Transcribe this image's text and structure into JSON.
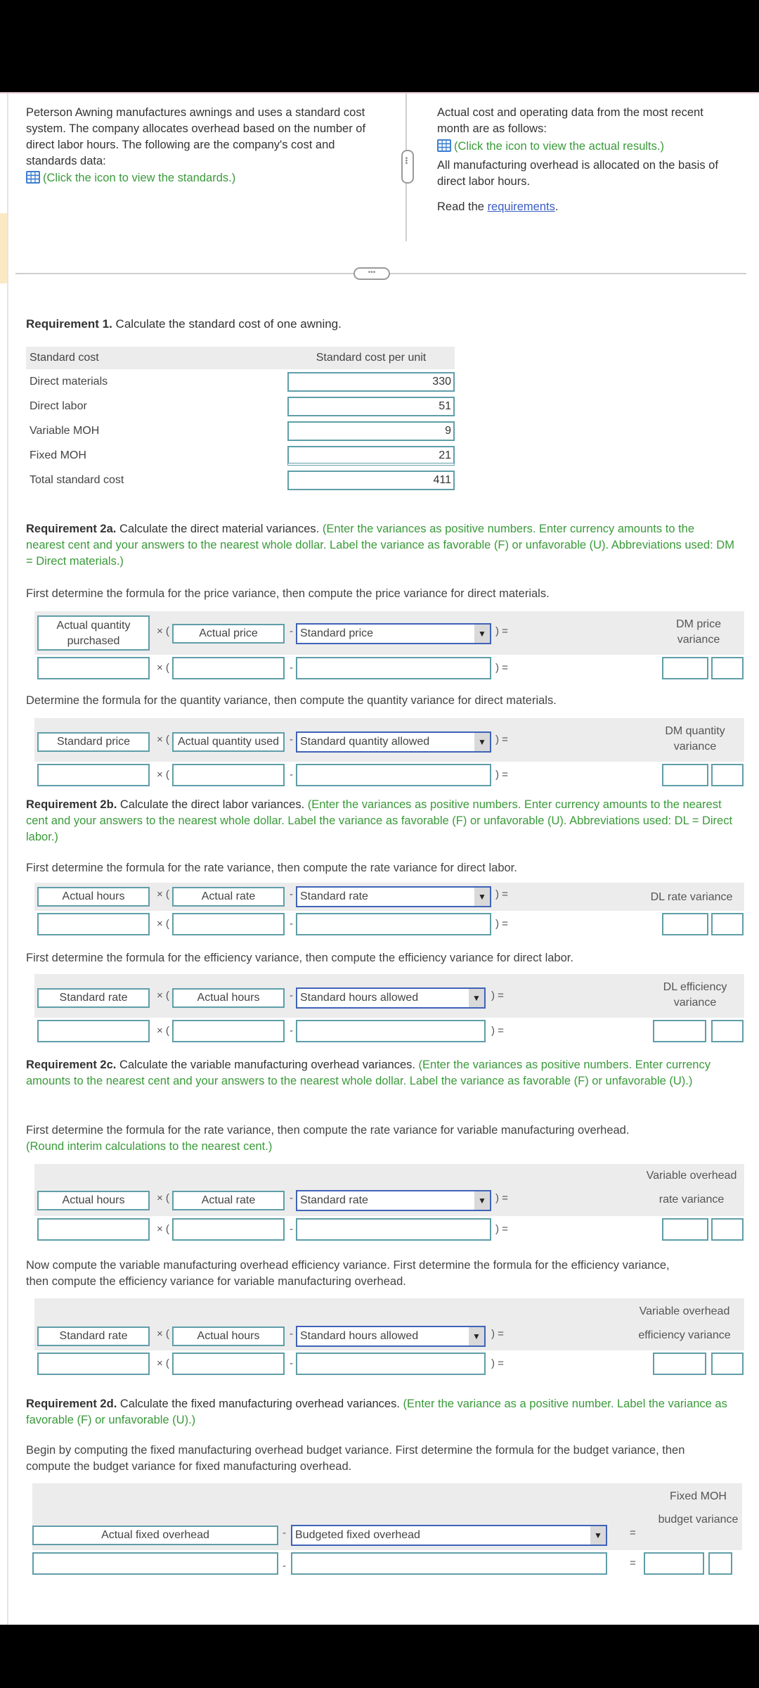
{
  "intro": {
    "left_text": "Peterson Awning manufactures awnings and uses a standard cost system. The company allocates overhead based on the number of direct labor hours. The following are the company's cost and standards data:",
    "left_link": "(Click the icon to view the standards.)",
    "right_text": "Actual cost and operating data from the most recent month are as follows:",
    "right_link": "(Click the icon to view the actual results.)",
    "right_text2": "All manufacturing overhead is allocated on the basis of direct labor hours.",
    "read_prefix": "Read the ",
    "read_link": "requirements",
    "read_suffix": "."
  },
  "req1": {
    "title_bold": "Requirement 1.",
    "title_rest": " Calculate the standard cost of one awning.",
    "col1": "Standard cost",
    "col2": "Standard cost per unit",
    "rows": [
      {
        "label": "Direct materials",
        "value": "330"
      },
      {
        "label": "Direct labor",
        "value": "51"
      },
      {
        "label": "Variable MOH",
        "value": "9"
      },
      {
        "label": "Fixed MOH",
        "value": "21"
      },
      {
        "label": "Total standard cost",
        "value": "411"
      }
    ]
  },
  "req2a": {
    "title_bold": "Requirement 2a.",
    "title_rest": " Calculate the direct material variances. ",
    "title_green": "(Enter the variances as positive numbers. Enter currency amounts to the nearest cent and your answers to the nearest whole dollar. Label the variance as favorable (F) or unfavorable (U). Abbreviations used: DM = Direct materials.)",
    "instr_price": "First determine the formula for the price variance, then compute the price variance for direct materials.",
    "price": {
      "a": "Actual quantity purchased",
      "b": "Actual price",
      "c": "Standard price",
      "result": "DM price variance"
    },
    "instr_qty": "Determine the formula for the quantity variance, then compute the quantity variance for direct materials.",
    "qty": {
      "a": "Standard price",
      "b": "Actual quantity used",
      "c": "Standard quantity allowed",
      "result": "DM quantity variance"
    }
  },
  "req2b": {
    "title_bold": "Requirement 2b.",
    "title_rest": " Calculate the direct labor variances. ",
    "title_green": "(Enter the variances as positive numbers. Enter currency amounts to the nearest cent and your answers to the nearest whole dollar. Label the variance as favorable (F) or unfavorable (U). Abbreviations used: DL = Direct labor.)",
    "instr_rate": "First determine the formula for the rate variance, then compute the rate variance for direct labor.",
    "rate": {
      "a": "Actual hours",
      "b": "Actual rate",
      "c": "Standard rate",
      "result": "DL rate variance"
    },
    "instr_eff": "First determine the formula for the efficiency variance, then compute the efficiency variance for direct labor.",
    "eff": {
      "a": "Standard rate",
      "b": "Actual hours",
      "c": "Standard hours allowed",
      "result": "DL efficiency variance"
    }
  },
  "req2c": {
    "title_bold": "Requirement 2c.",
    "title_rest": " Calculate the variable manufacturing overhead variances. ",
    "title_green": "(Enter the variances as positive numbers. Enter currency amounts to the nearest cent and your answers to the nearest whole dollar. Label the variance as favorable (F) or unfavorable (U).)",
    "instr_rate": "First determine the formula for the rate variance, then compute the rate variance for variable manufacturing overhead.",
    "instr_rate_green": "(Round interim calculations to the nearest cent.)",
    "rate": {
      "a": "Actual hours",
      "b": "Actual rate",
      "c": "Standard rate",
      "result1": "Variable overhead",
      "result2": "rate variance"
    },
    "instr_eff": "Now compute the variable manufacturing overhead efficiency variance. First determine the formula for the efficiency variance, then compute the efficiency variance for variable manufacturing overhead.",
    "eff": {
      "a": "Standard rate",
      "b": "Actual hours",
      "c": "Standard hours allowed",
      "result1": "Variable overhead",
      "result2": "efficiency variance"
    }
  },
  "req2d": {
    "title_bold": "Requirement 2d.",
    "title_rest": " Calculate the fixed manufacturing overhead variances. ",
    "title_green": "(Enter the variance as a positive number. Label the variance as favorable (F) or unfavorable (U).)",
    "instr_budget": "Begin by computing the fixed manufacturing overhead budget variance. First determine the formula for the budget variance, then compute the budget variance for fixed manufacturing overhead.",
    "budget": {
      "a": "Actual fixed overhead",
      "c": "Budgeted fixed overhead",
      "result1": "Fixed MOH",
      "result2": "budget variance"
    }
  },
  "symbols": {
    "times": "× (",
    "minus": "-",
    "close_eq": ") =",
    "eq": "=",
    "dropdown": "▼",
    "handle": "•••"
  }
}
